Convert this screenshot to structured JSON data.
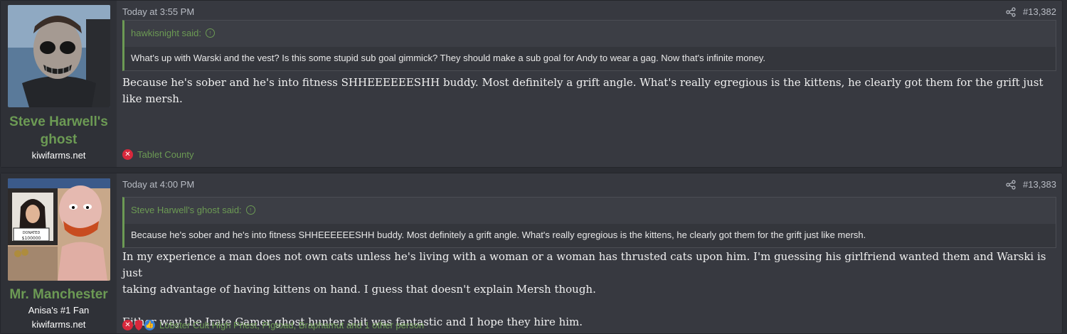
{
  "posts": [
    {
      "username": "Steve Harwell's ghost",
      "user_titles": [
        "kiwifarms.net"
      ],
      "timestamp": "Today at 3:55 PM",
      "post_number": "#13,382",
      "quote": {
        "author": "hawkisnight said:",
        "text": "What's up with Warski and the vest? Is this some stupid sub goal gimmick? They should make a sub goal for Andy to wear a gag. Now that's infinite money."
      },
      "message": [
        "Because he's sober and he's into fitness SHHEEEEEESHH buddy. Most definitely a grift angle. What's really egregious is the kittens, he clearly got them for the grift just like mersh."
      ],
      "reactions": {
        "icons": [
          "x-icon"
        ],
        "label": "Tablet County"
      }
    },
    {
      "username": "Mr. Manchester",
      "user_titles": [
        "Anisa's #1 Fan",
        "kiwifarms.net"
      ],
      "timestamp": "Today at 4:00 PM",
      "post_number": "#13,383",
      "quote": {
        "author": "Steve Harwell's ghost said:",
        "text": "Because he's sober and he's into fitness SHHEEEEEESHH buddy. Most definitely a grift angle. What's really egregious is the kittens, he clearly got them for the grift just like mersh."
      },
      "message": [
        "In my experience a man does not own cats unless he's living with a woman or a woman has thrusted cats upon him. I'm guessing his girlfriend wanted them and Warski is just",
        "taking advantage of having kittens on hand. I guess that doesn't explain Mersh though.",
        "Either way the Irate Gamer ghost hunter shit was fantastic and I hope they hire him."
      ],
      "reactions": {
        "icons": [
          "x-icon",
          "shield-icon",
          "like-icon"
        ],
        "label": "Lobster Cult High Priest, Pigtoad, Braphamut and 1 other person"
      },
      "avatar_texts": [
        "DONATED",
        "$100000"
      ]
    }
  ],
  "colors": {
    "username": "#6c9a54",
    "post_bg": "#373940",
    "quote_accent": "#6c9a54",
    "reaction_negative": "#d8283c",
    "reaction_like": "#3a80d8"
  }
}
